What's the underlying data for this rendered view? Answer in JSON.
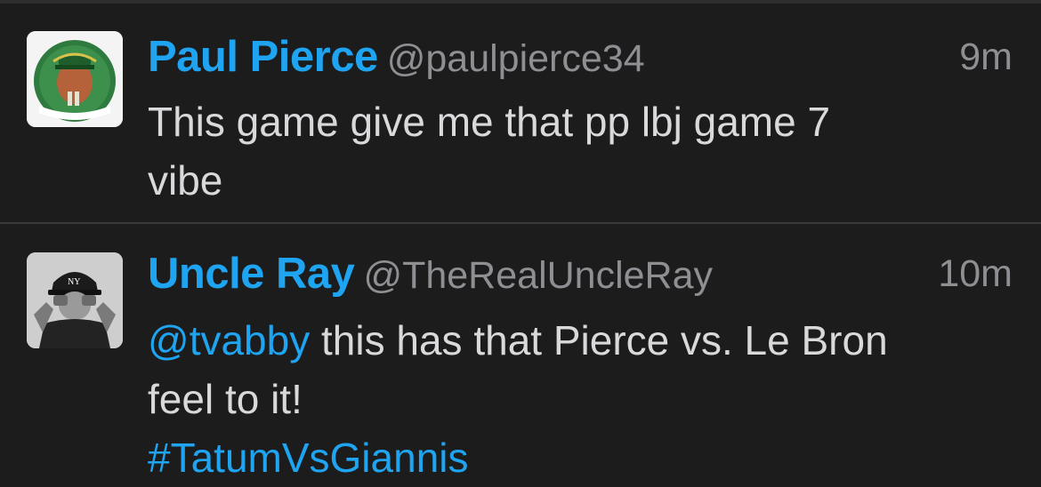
{
  "tweets": [
    {
      "name": "Paul Pierce",
      "handle": "@paulpierce34",
      "time": "9m",
      "text_line1": "This game give me that pp lbj game 7",
      "text_line2": "vibe"
    },
    {
      "name": "Uncle Ray",
      "handle": "@TheRealUncleRay",
      "time": "10m",
      "mention": "@tvabby",
      "text_line1_rest": " this has that Pierce vs. Le Bron",
      "text_line2": "feel to it!",
      "hashtag": "#TatumVsGiannis"
    }
  ],
  "colors": {
    "background": "#1c1c1d",
    "accent": "#1ea4f0",
    "body_text": "#d9d9db",
    "secondary_text": "#8e8e93",
    "divider": "#3a3a3c"
  }
}
